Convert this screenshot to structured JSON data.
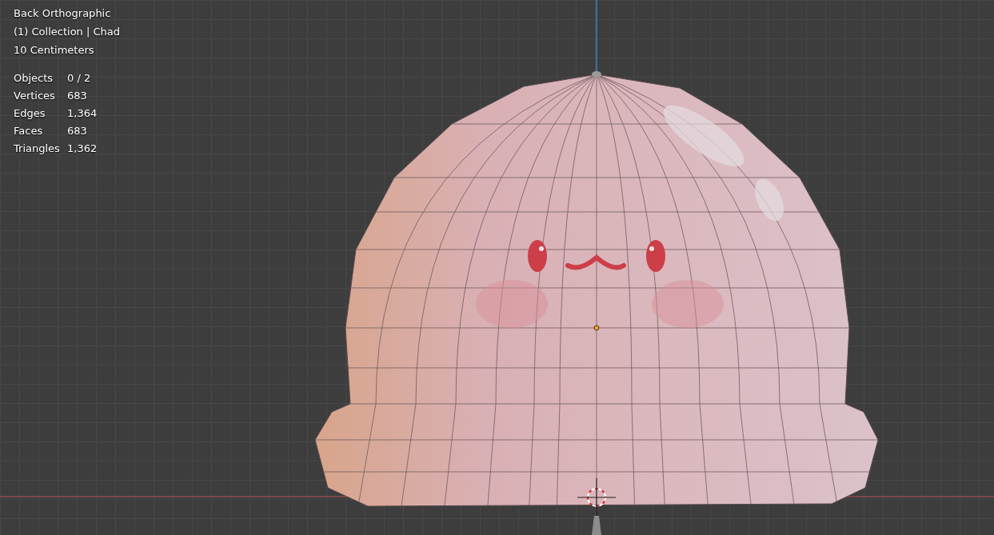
{
  "viewport": {
    "view_name": "Back Orthographic",
    "collection": "(1) Collection | Chad",
    "scale": "10 Centimeters",
    "stats": [
      {
        "label": "Objects",
        "value": "0 / 2"
      },
      {
        "label": "Vertices",
        "value": "683"
      },
      {
        "label": "Edges",
        "value": "1,364"
      },
      {
        "label": "Faces",
        "value": "683"
      },
      {
        "label": "Triangles",
        "value": "1,362"
      }
    ]
  }
}
